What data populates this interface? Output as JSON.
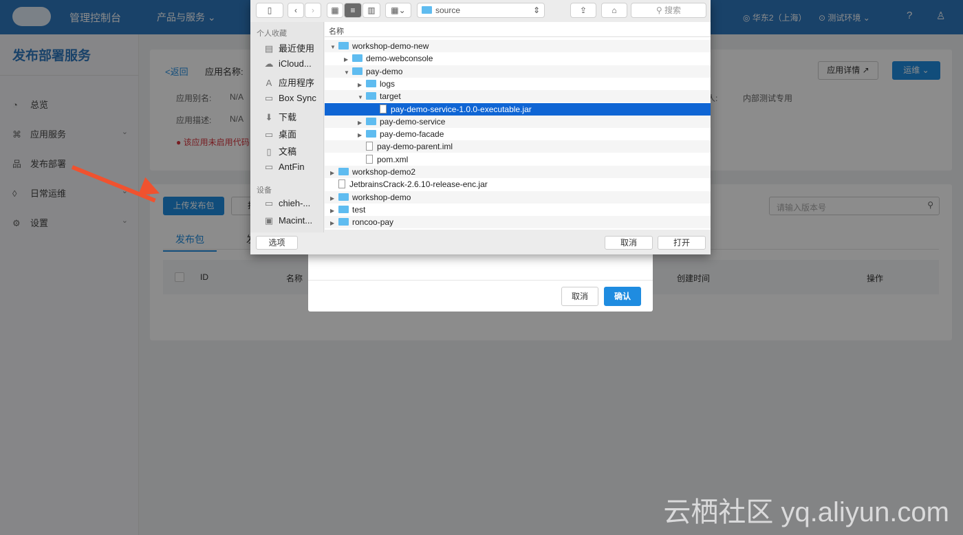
{
  "header": {
    "title": "管理控制台",
    "products": "产品与服务",
    "region": "华东2（上海）",
    "env": "测试环境",
    "icons": [
      "cloud-logo",
      "location-icon",
      "env-icon",
      "help-icon",
      "user-icon"
    ]
  },
  "sidebar": {
    "title": "发布部署服务",
    "items": [
      {
        "label": "总览",
        "icon": "dashboard-icon"
      },
      {
        "label": "应用服务",
        "icon": "apps-icon"
      },
      {
        "label": "发布部署",
        "icon": "deploy-icon"
      },
      {
        "label": "日常运维",
        "icon": "rocket-icon"
      },
      {
        "label": "设置",
        "icon": "gear-icon"
      }
    ]
  },
  "app": {
    "back": "返回",
    "name_label": "应用名称:",
    "alias_label": "应用别名:",
    "alias": "N/A",
    "desc_label": "应用描述:",
    "desc": "N/A",
    "warning": "该应用未启用代码",
    "owner_label": "人:",
    "owner": "内部测试专用",
    "details_btn": "应用详情",
    "ops_btn": "运维"
  },
  "packages": {
    "upload_btn": "上传发布包",
    "batch_btn": "批",
    "search_placeholder": "请输入版本号",
    "tabs": [
      "发布包",
      "发"
    ],
    "columns": [
      "ID",
      "名称",
      "创建时间",
      "操作"
    ]
  },
  "modal": {
    "cancel": "取消",
    "confirm": "确认"
  },
  "file_dialog": {
    "location": "source",
    "search_placeholder": "搜索",
    "favorites_header": "个人收藏",
    "favorites": [
      "最近使用",
      "iCloud...",
      "应用程序",
      "Box Sync",
      "下载",
      "桌面",
      "文稿",
      "AntFin"
    ],
    "devices_header": "设备",
    "devices": [
      "chieh-...",
      "Macint..."
    ],
    "column_name": "名称",
    "options": "选项",
    "cancel": "取消",
    "open": "打开",
    "files": [
      {
        "name": "workshop-demo-new",
        "level": 0,
        "type": "folder",
        "expanded": true
      },
      {
        "name": "demo-webconsole",
        "level": 1,
        "type": "folder",
        "expanded": false
      },
      {
        "name": "pay-demo",
        "level": 1,
        "type": "folder",
        "expanded": true
      },
      {
        "name": "logs",
        "level": 2,
        "type": "folder",
        "expanded": false
      },
      {
        "name": "target",
        "level": 2,
        "type": "folder",
        "expanded": true
      },
      {
        "name": "pay-demo-service-1.0.0-executable.jar",
        "level": 3,
        "type": "file",
        "selected": true
      },
      {
        "name": "pay-demo-service",
        "level": 2,
        "type": "folder",
        "expanded": false
      },
      {
        "name": "pay-demo-facade",
        "level": 2,
        "type": "folder",
        "expanded": false
      },
      {
        "name": "pay-demo-parent.iml",
        "level": 2,
        "type": "file"
      },
      {
        "name": "pom.xml",
        "level": 2,
        "type": "file"
      },
      {
        "name": "workshop-demo2",
        "level": 0,
        "type": "folder",
        "expanded": false
      },
      {
        "name": "JetbrainsCrack-2.6.10-release-enc.jar",
        "level": 0,
        "type": "file"
      },
      {
        "name": "workshop-demo",
        "level": 0,
        "type": "folder",
        "expanded": false
      },
      {
        "name": "test",
        "level": 0,
        "type": "folder",
        "expanded": false
      },
      {
        "name": "roncoo-pay",
        "level": 0,
        "type": "folder",
        "expanded": false
      }
    ]
  },
  "watermark": "云栖社区 yq.aliyun.com"
}
